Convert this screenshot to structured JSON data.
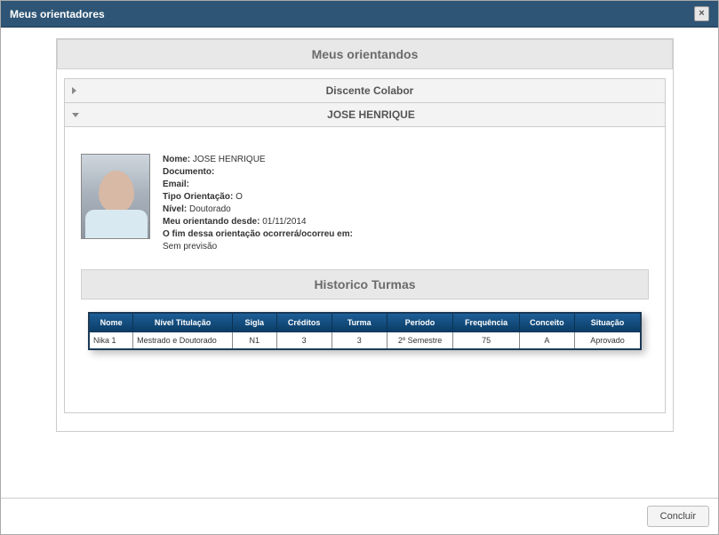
{
  "dialog": {
    "title": "Meus orientadores",
    "close_label": "×"
  },
  "main": {
    "heading": "Meus orientandos"
  },
  "accordion": {
    "collapsed_label": "Discente Colabor",
    "expanded_label": "JOSE HENRIQUE"
  },
  "student": {
    "labels": {
      "nome": "Nome:",
      "documento": "Documento:",
      "email": "Email:",
      "tipo_orientacao": "Tipo Orientação:",
      "nivel": "Nível:",
      "desde": "Meu orientando desde:",
      "fim": "O fim dessa orientação ocorrerá/ocorreu em:",
      "sem_previsao": "Sem previsão"
    },
    "values": {
      "nome": "JOSE HENRIQUE",
      "documento": "",
      "email": "",
      "tipo_orientacao": "O",
      "nivel": "Doutorado",
      "desde": "01/11/2014",
      "fim": ""
    }
  },
  "history": {
    "heading": "Historico Turmas",
    "columns": {
      "nome": "Nome",
      "nivel_titulacao": "Nível Titulação",
      "sigla": "Sigla",
      "creditos": "Créditos",
      "turma": "Turma",
      "periodo": "Período",
      "frequencia": "Frequência",
      "conceito": "Conceito",
      "situacao": "Situação"
    },
    "rows": [
      {
        "nome": "Nika 1",
        "nivel_titulacao": "Mestrado e Doutorado",
        "sigla": "N1",
        "creditos": "3",
        "turma": "3",
        "periodo": "2º Semestre",
        "frequencia": "75",
        "conceito": "A",
        "situacao": "Aprovado"
      }
    ]
  },
  "footer": {
    "concluir": "Concluir"
  }
}
